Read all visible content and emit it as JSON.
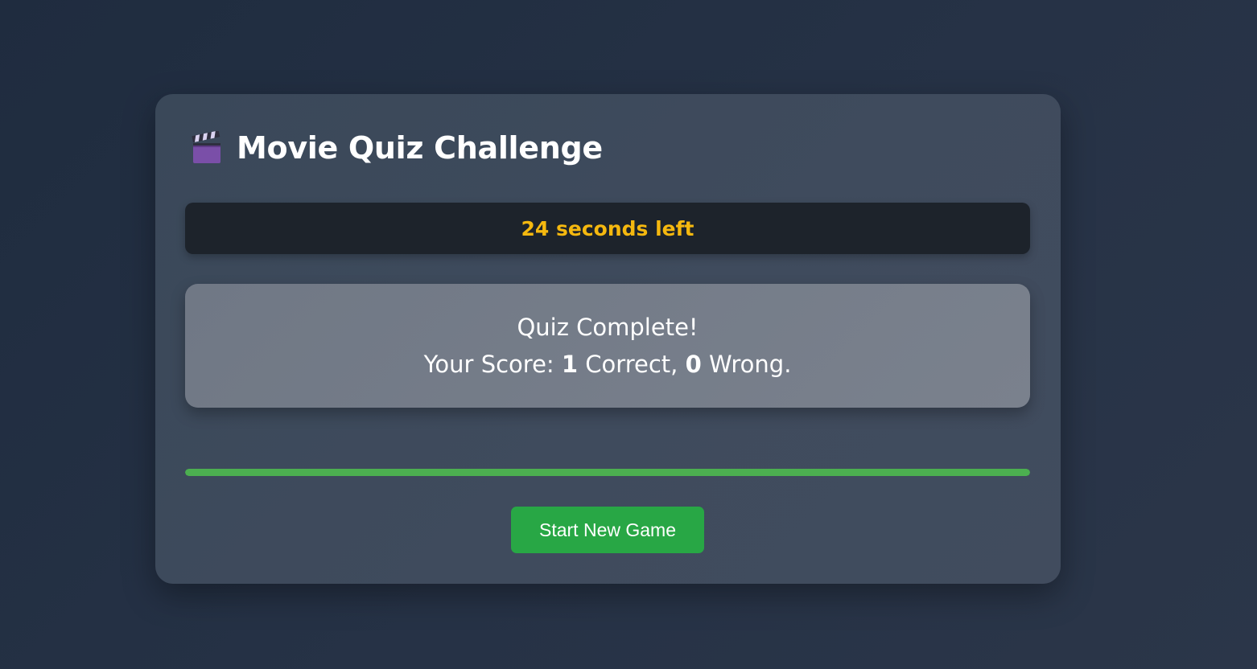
{
  "app": {
    "title": "Movie Quiz Challenge",
    "title_icon": "clapperboard-icon"
  },
  "timer": {
    "text": "24 seconds left"
  },
  "result": {
    "heading": "Quiz Complete!",
    "score_prefix": "Your Score: ",
    "correct": "1",
    "correct_label": " Correct, ",
    "wrong": "0",
    "wrong_label": " Wrong."
  },
  "progress": {
    "value": 1.0
  },
  "actions": {
    "start_label": "Start New Game"
  },
  "colors": {
    "background": "#263246",
    "card": "#3f4b5d",
    "timer_bg": "#1d232b",
    "timer_text": "#f5b80f",
    "result_bg": "#767e8a",
    "progress": "#4caf50",
    "button": "#28a745"
  }
}
